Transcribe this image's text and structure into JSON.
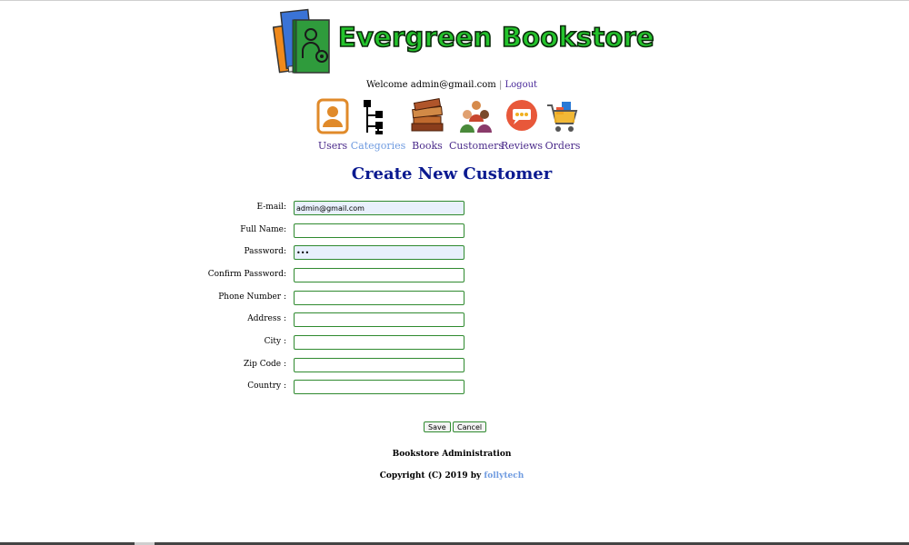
{
  "header": {
    "brand": "Evergreen Bookstore",
    "welcome_text": "Welcome admin@gmail.com",
    "separator": "|",
    "logout_label": "Logout"
  },
  "nav": {
    "items": [
      {
        "label": "Users",
        "icon": "user-icon"
      },
      {
        "label": "Categories",
        "icon": "category-tree-icon"
      },
      {
        "label": "Books",
        "icon": "books-icon"
      },
      {
        "label": "Customers",
        "icon": "customers-icon"
      },
      {
        "label": "Reviews",
        "icon": "reviews-icon"
      },
      {
        "label": "Orders",
        "icon": "cart-icon"
      }
    ],
    "active": "Categories"
  },
  "page": {
    "title": "Create New Customer"
  },
  "form": {
    "fields": [
      {
        "label": "E-mail:",
        "value": "admin@gmail.com"
      },
      {
        "label": "Full Name:",
        "value": ""
      },
      {
        "label": "Password:",
        "value": "•••"
      },
      {
        "label": "Confirm Password:",
        "value": ""
      },
      {
        "label": "Phone Number :",
        "value": ""
      },
      {
        "label": "Address :",
        "value": ""
      },
      {
        "label": "City :",
        "value": ""
      },
      {
        "label": "Zip Code :",
        "value": ""
      },
      {
        "label": "Country :",
        "value": ""
      }
    ],
    "save_label": "Save",
    "cancel_label": "Cancel"
  },
  "footer": {
    "title": "Bookstore Administration",
    "copyright_prefix": "Copyright (C) 2019 by",
    "author_link": "follytech"
  },
  "colors": {
    "brand_green": "#24c42c",
    "title_blue": "#0b1a90",
    "link_purple": "#4a2a9a",
    "active_blue": "#6f9be0",
    "input_border": "#2f8a2f"
  }
}
